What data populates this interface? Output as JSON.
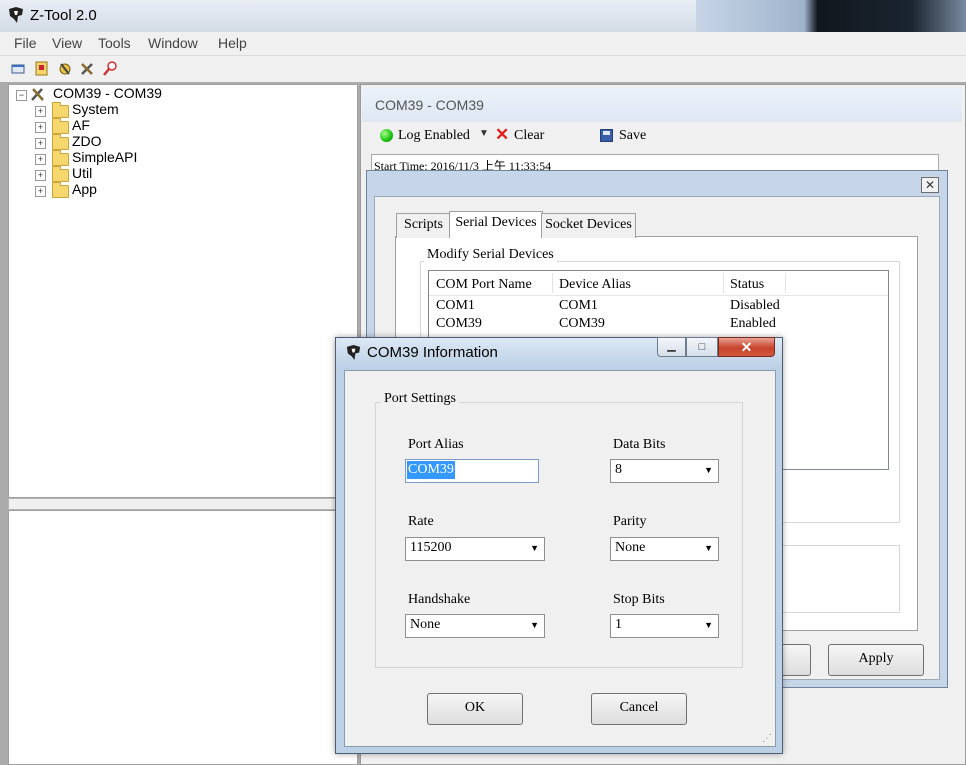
{
  "window": {
    "title": "Z-Tool 2.0"
  },
  "menu": [
    "File",
    "View",
    "Tools",
    "Window",
    "Help"
  ],
  "toolbar": {
    "icons": [
      "new-window-icon",
      "device-icon",
      "script-icon",
      "tools-icon",
      "find-icon"
    ]
  },
  "tree": {
    "root": "COM39 - COM39",
    "items": [
      "System",
      "AF",
      "ZDO",
      "SimpleAPI",
      "Util",
      "App"
    ]
  },
  "document": {
    "title": "COM39 - COM39",
    "log_label": "Log Enabled",
    "clear_label": "Clear",
    "save_label": "Save",
    "start_time": "Start Time: 2016/11/3 上午 11:33:54"
  },
  "serial_dialog": {
    "close": "✕",
    "tabs": [
      "Scripts",
      "Serial Devices",
      "Socket Devices"
    ],
    "active_tab": "Serial Devices",
    "group_title": "Modify Serial Devices",
    "columns": [
      "COM Port Name",
      "Device Alias",
      "Status"
    ],
    "rows": [
      {
        "port": "COM1",
        "alias": "COM1",
        "status": "Disabled"
      },
      {
        "port": "COM39",
        "alias": "COM39",
        "status": "Enabled"
      }
    ],
    "apply_label": "Apply"
  },
  "info_dialog": {
    "title": "COM39 Information",
    "group_title": "Port Settings",
    "port_alias_label": "Port Alias",
    "port_alias_value": "COM39",
    "data_bits_label": "Data Bits",
    "data_bits_value": "8",
    "rate_label": "Rate",
    "rate_value": "115200",
    "parity_label": "Parity",
    "parity_value": "None",
    "handshake_label": "Handshake",
    "handshake_value": "None",
    "stop_bits_label": "Stop Bits",
    "stop_bits_value": "1",
    "ok_label": "OK",
    "cancel_label": "Cancel"
  }
}
